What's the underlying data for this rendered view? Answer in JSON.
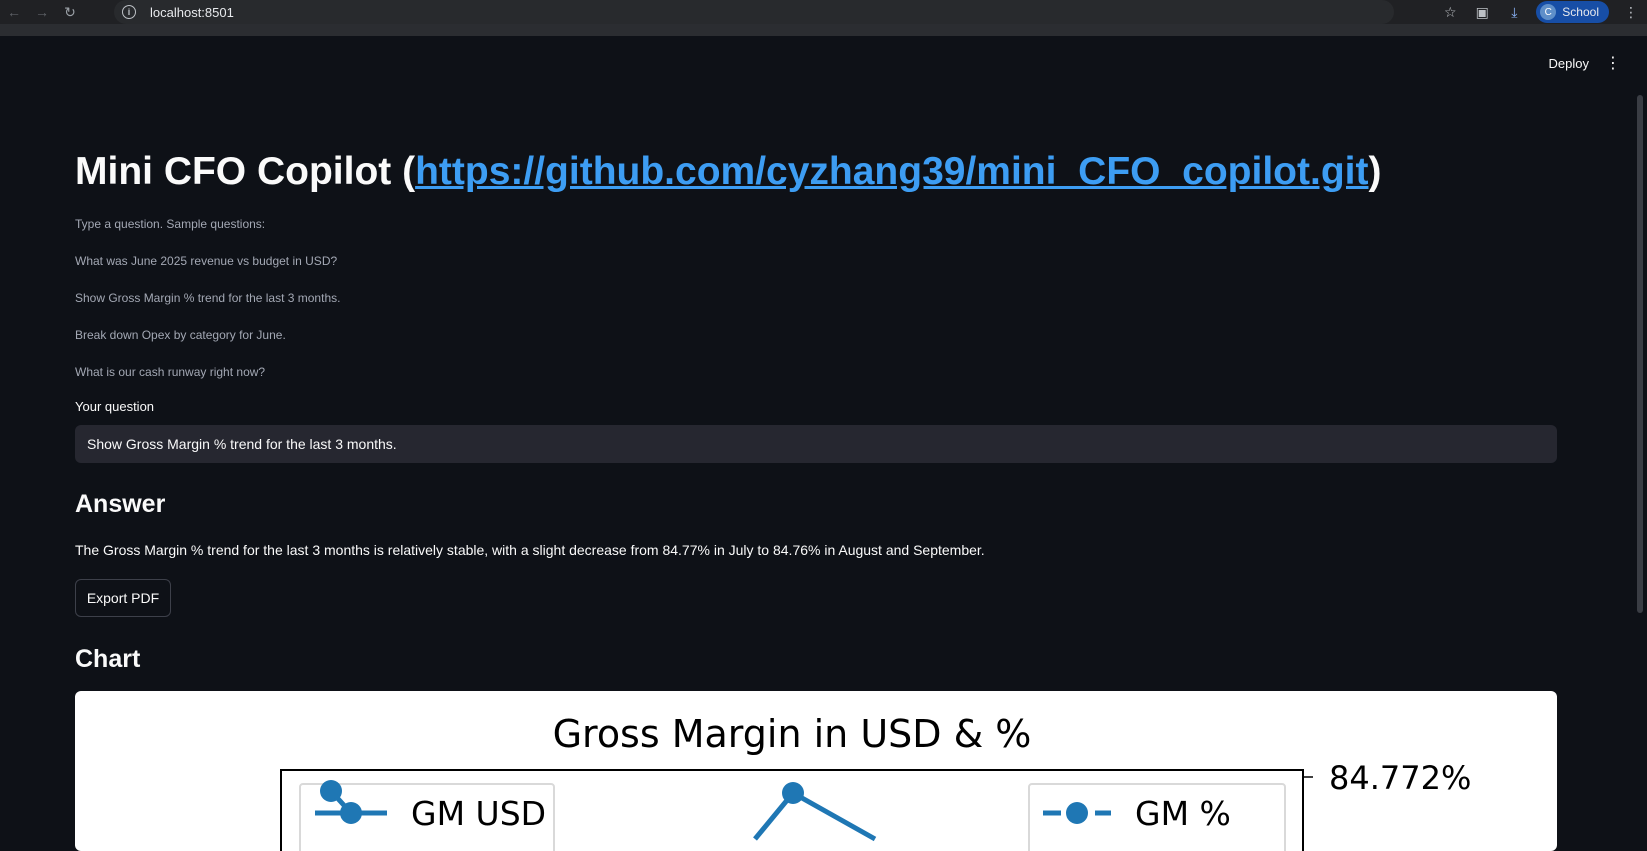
{
  "browser": {
    "url": "localhost:8501",
    "profile_initial": "C",
    "profile_name": "School"
  },
  "header": {
    "deploy_label": "Deploy"
  },
  "app": {
    "title_prefix": "Mini CFO Copilot (",
    "title_link": "https://github.com/cyzhang39/mini_CFO_copilot.git",
    "title_suffix": ")",
    "intro": "Type a question. Sample questions:",
    "samples": [
      "What was June 2025 revenue vs budget in USD?",
      "Show Gross Margin % trend for the last 3 months.",
      "Break down Opex by category for June.",
      "What is our cash runway right now?"
    ],
    "question_label": "Your question",
    "question_value": "Show Gross Margin % trend for the last 3 months.",
    "answer_heading": "Answer",
    "answer_text": "The Gross Margin % trend for the last 3 months is relatively stable, with a slight decrease from 84.77% in July to 84.76% in August and September.",
    "export_label": "Export PDF",
    "chart_heading": "Chart"
  },
  "chart_data": {
    "type": "line",
    "title": "Gross Margin in USD & %",
    "legend": [
      "GM USD",
      "GM %"
    ],
    "y2_tick_labels": [
      "84.772%"
    ],
    "colors": {
      "series": "#1f77b4"
    }
  }
}
